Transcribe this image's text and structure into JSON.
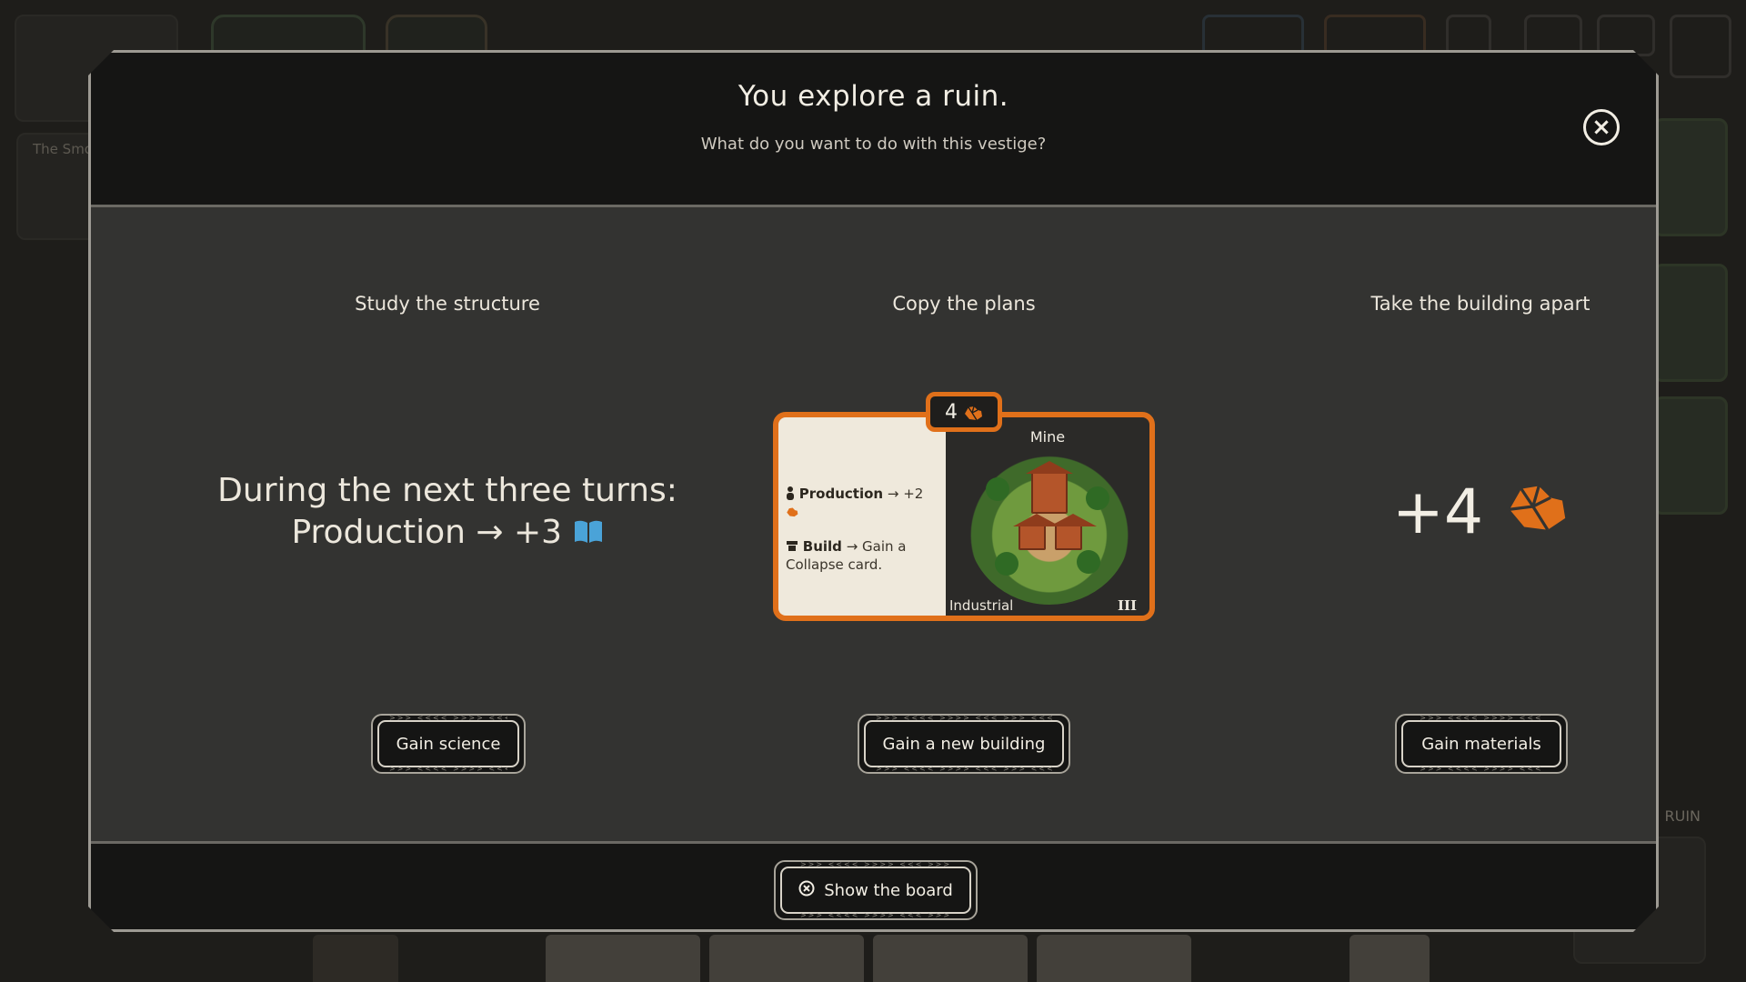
{
  "modal": {
    "title": "You explore a ruin.",
    "subtitle": "What do you want to do with this vestige?"
  },
  "options": [
    {
      "title": "Study the structure",
      "line1": "During the next three turns:",
      "line2": "Production → +3",
      "icon": "science-book-icon",
      "button": "Gain science"
    },
    {
      "title": "Copy the plans",
      "button": "Gain a new building",
      "card": {
        "cost": "4",
        "name": "Mine",
        "production_label": "Production",
        "production_arrow": "→ +2",
        "build_label": "Build",
        "build_text": "→ Gain a Collapse card.",
        "type": "Industrial",
        "era": "III"
      }
    },
    {
      "title": "Take the building apart",
      "value": "+4",
      "icon": "materials-icon",
      "button": "Gain materials"
    }
  ],
  "footer": {
    "show_board_label": "Show the board"
  },
  "background": {
    "partial_text": "The Smo",
    "ruin_label": "RUIN"
  },
  "colors": {
    "accent_orange": "#e0701a",
    "science_blue": "#4aa3d8",
    "modal_bg": "#151514",
    "body_bg": "#333331"
  }
}
